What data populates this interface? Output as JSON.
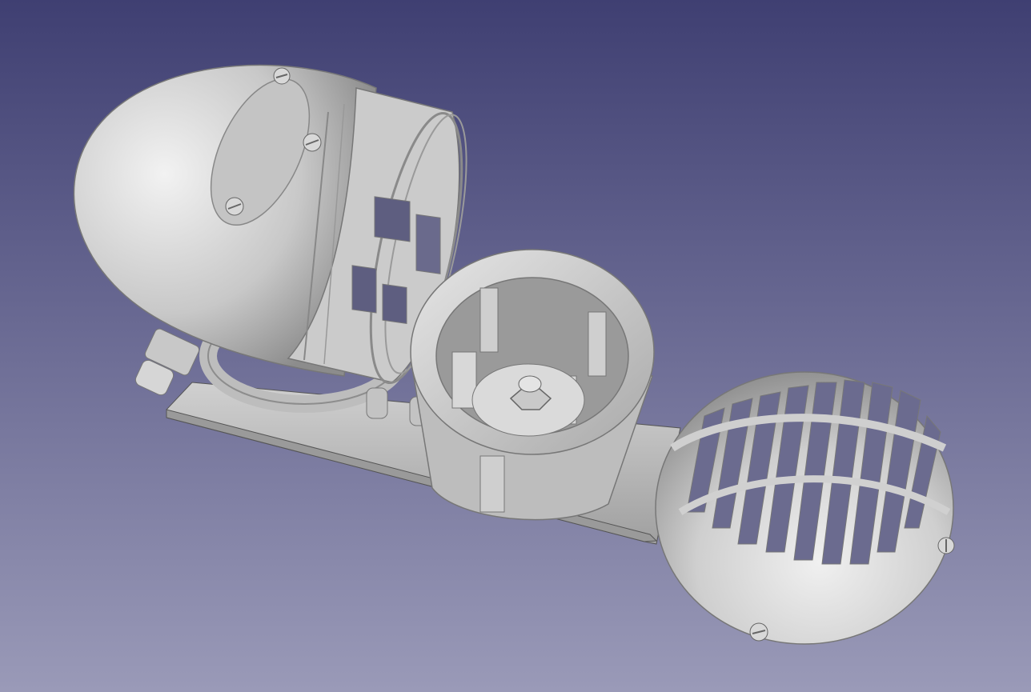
{
  "app": {
    "view": "3D viewport",
    "background_top": "#3f3f72",
    "background_bottom": "#9a9ab8"
  },
  "model": {
    "material_color": "#c9c9c9",
    "parts": [
      {
        "name": "bullet-housing",
        "kind": "rounded shell with louvered collar"
      },
      {
        "name": "fan-ring",
        "kind": "ring with internal vanes and hex nut"
      },
      {
        "name": "spherical-grille",
        "kind": "slotted hemisphere"
      },
      {
        "name": "base-plate",
        "kind": "flat rectangular plate"
      },
      {
        "name": "mount-bracket",
        "kind": "curved tube with bolt"
      }
    ]
  }
}
